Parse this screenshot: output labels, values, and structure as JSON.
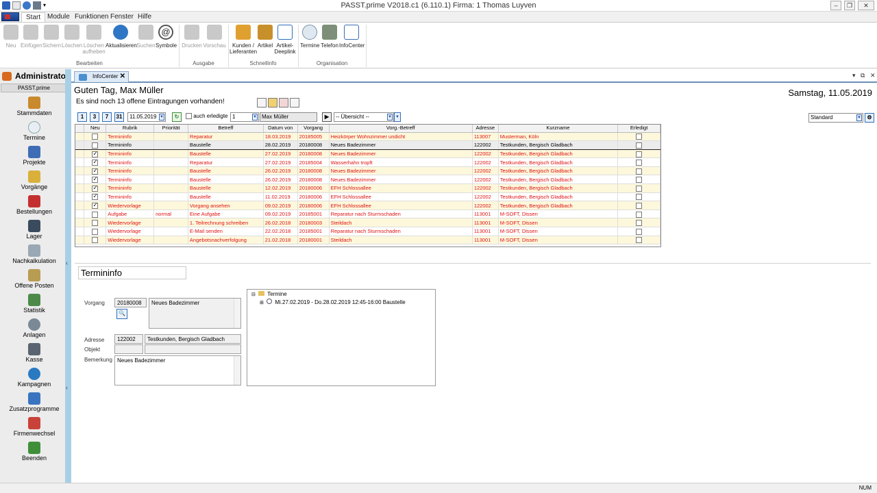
{
  "window": {
    "title": "PASST.prime   V2018.c1 (6.110.1)          Firma: 1   Thomas Luyven"
  },
  "menu": {
    "tabs": [
      "Start",
      "Module",
      "Funktionen",
      "Fenster",
      "Hilfe"
    ]
  },
  "ribbon": {
    "buttons": [
      "Neu",
      "Einfügen",
      "Sichern",
      "Löschen",
      "Löschen\naufheben",
      "Aktualisieren",
      "Suchen",
      "Symbole",
      "Drucken",
      "Vorschau",
      "Kunden /\nLieferanten",
      "Artikel",
      "Artikel-\nDeeplink",
      "Termine",
      "Telefon",
      "InfoCenter"
    ],
    "groups": [
      "Bearbeiten",
      "Ausgabe",
      "Schnellinfo",
      "Organisation"
    ]
  },
  "sidebar": {
    "user": "Administrator",
    "product": "PASST.prime",
    "items": [
      "Stammdaten",
      "Termine",
      "Projekte",
      "Vorgänge",
      "Bestellungen",
      "Lager",
      "Nachkalkulation",
      "Offene Posten",
      "Statistik",
      "Anlagen",
      "Kasse",
      "Kampagnen",
      "Zusatzprogramme",
      "Firmenwechsel",
      "Beenden"
    ]
  },
  "doctab": {
    "label": "InfoCenter"
  },
  "info": {
    "greeting": "Guten Tag, Max Müller",
    "date": "Samstag, 11.05.2019",
    "open_entries": "Es sind noch 13 offene Eintragungen vorhanden!",
    "filter_buttons": [
      "1",
      "3",
      "7",
      "31"
    ],
    "date_field": "11.05.2019",
    "auch_erledigte": "auch erledigte",
    "count_field": "1",
    "user_field": "Max Müller",
    "overview_select": "-- Übersicht --",
    "view_select": "Standard"
  },
  "table": {
    "headers": [
      "Neu",
      "Rubrik",
      "Priorität",
      "Betreff",
      "Datum von",
      "Vorgang",
      "Vorg.-Betreff",
      "Adresse",
      "Kurzname",
      "Erledigt"
    ],
    "rows": [
      {
        "neu": false,
        "rubrik": "Termininfo",
        "prio": "",
        "betreff": "Reparatur",
        "datum": "18.03.2019",
        "vorgang": "20185005",
        "vbetreff": "Heizkörper Wohnzimmer undicht",
        "adresse": "113007",
        "kurzname": "Musterman, Köln",
        "erledigt": false
      },
      {
        "neu": false,
        "rubrik": "Termininfo",
        "prio": "",
        "betreff": "Baustelle",
        "datum": "28.02.2019",
        "vorgang": "20180008",
        "vbetreff": "Neues Badezimmer",
        "adresse": "122002",
        "kurzname": "Testkunden, Bergisch Gladbach",
        "erledigt": false
      },
      {
        "neu": true,
        "rubrik": "Termininfo",
        "prio": "",
        "betreff": "Baustelle",
        "datum": "27.02.2019",
        "vorgang": "20180008",
        "vbetreff": "Neues Badezimmer",
        "adresse": "122002",
        "kurzname": "Testkunden, Bergisch Gladbach",
        "erledigt": false
      },
      {
        "neu": true,
        "rubrik": "Termininfo",
        "prio": "",
        "betreff": "Reparatur",
        "datum": "27.02.2019",
        "vorgang": "20185004",
        "vbetreff": "Wasserhahn tropft",
        "adresse": "122002",
        "kurzname": "Testkunden, Bergisch Gladbach",
        "erledigt": false
      },
      {
        "neu": true,
        "rubrik": "Termininfo",
        "prio": "",
        "betreff": "Baustelle",
        "datum": "26.02.2019",
        "vorgang": "20180008",
        "vbetreff": "Neues Badezimmer",
        "adresse": "122002",
        "kurzname": "Testkunden, Bergisch Gladbach",
        "erledigt": false
      },
      {
        "neu": true,
        "rubrik": "Termininfo",
        "prio": "",
        "betreff": "Baustelle",
        "datum": "26.02.2019",
        "vorgang": "20180008",
        "vbetreff": "Neues Badezimmer",
        "adresse": "122002",
        "kurzname": "Testkunden, Bergisch Gladbach",
        "erledigt": false
      },
      {
        "neu": true,
        "rubrik": "Termininfo",
        "prio": "",
        "betreff": "Baustelle",
        "datum": "12.02.2019",
        "vorgang": "20180006",
        "vbetreff": "EFH Schlossallee",
        "adresse": "122002",
        "kurzname": "Testkunden, Bergisch Gladbach",
        "erledigt": false
      },
      {
        "neu": true,
        "rubrik": "Termininfo",
        "prio": "",
        "betreff": "Baustelle",
        "datum": "11.02.2019",
        "vorgang": "20180006",
        "vbetreff": "EFH Schlossallee",
        "adresse": "122002",
        "kurzname": "Testkunden, Bergisch Gladbach",
        "erledigt": false
      },
      {
        "neu": true,
        "rubrik": "Wiedervorlage",
        "prio": "",
        "betreff": "Vorgang ansehen",
        "datum": "09.02.2019",
        "vorgang": "20180006",
        "vbetreff": "EFH Schlossallee",
        "adresse": "122002",
        "kurzname": "Testkunden, Bergisch Gladbach",
        "erledigt": false
      },
      {
        "neu": false,
        "rubrik": "Aufgabe",
        "prio": "normal",
        "betreff": "Eine Aufgabe",
        "datum": "09.02.2019",
        "vorgang": "20185001",
        "vbetreff": "Reparatur nach Sturmschaden",
        "adresse": "113001",
        "kurzname": "M-SOFT, Dissen",
        "erledigt": false
      },
      {
        "neu": false,
        "rubrik": "Wiedervorlage",
        "prio": "",
        "betreff": "1. Teilrechnung schreiben",
        "datum": "26.02.2018",
        "vorgang": "20180003",
        "vbetreff": "Steildach",
        "adresse": "113001",
        "kurzname": "M-SOFT, Dissen",
        "erledigt": false
      },
      {
        "neu": false,
        "rubrik": "Wiedervorlage",
        "prio": "",
        "betreff": "E-Mail senden",
        "datum": "22.02.2018",
        "vorgang": "20185001",
        "vbetreff": "Reparatur nach Sturmschaden",
        "adresse": "113001",
        "kurzname": "M-SOFT, Dissen",
        "erledigt": false
      },
      {
        "neu": false,
        "rubrik": "Wiedervorlage",
        "prio": "",
        "betreff": " Angebotsnachverfolgung",
        "datum": "21.02.2018",
        "vorgang": "20180001",
        "vbetreff": "Steildach",
        "adresse": "113001",
        "kurzname": "M-SOFT, Dissen",
        "erledigt": false
      }
    ]
  },
  "detail": {
    "title": "Termininfo",
    "vorgang_label": "Vorgang",
    "vorgang_nr": "20180008",
    "vorgang_text": "Neues Badezimmer",
    "adresse_label": "Adresse",
    "adresse_nr": "122002",
    "adresse_text": "Testkunden, Bergisch Gladbach",
    "objekt_label": "Objekt",
    "bemerkung_label": "Bemerkung",
    "bemerkung_text": "Neues Badezimmer",
    "tree_root": "Termine",
    "tree_item": "Mi.27.02.2019 - Do.28.02.2019 12:45-16:00  Baustelle"
  },
  "status": {
    "num": "NUM"
  },
  "colors": {
    "accent": "#2f6eb8",
    "red_text": "#e01212",
    "row_alt": "#fdf8dc"
  }
}
